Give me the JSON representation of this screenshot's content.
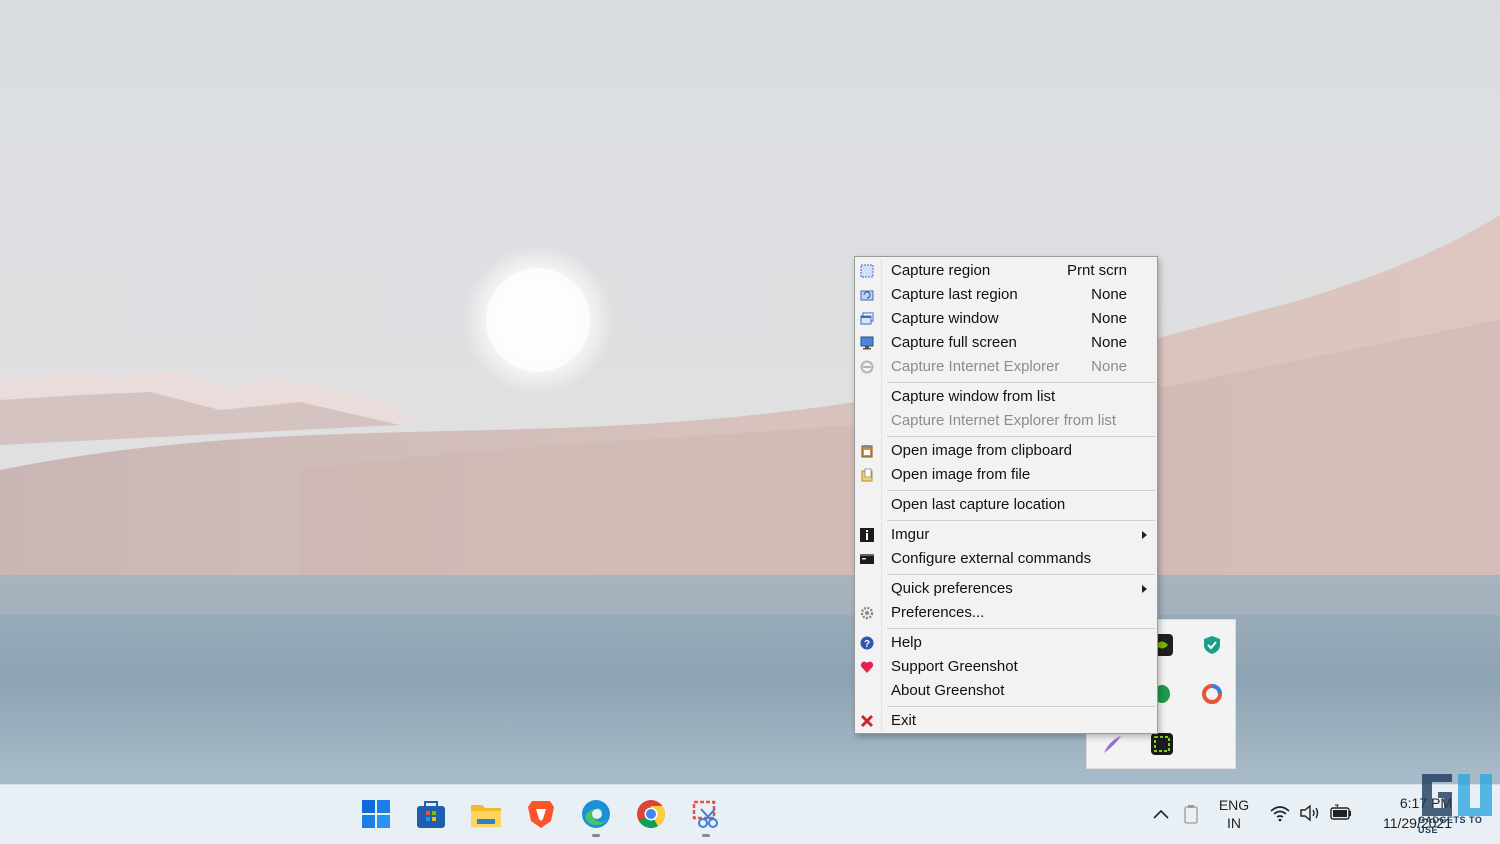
{
  "menu": {
    "items": [
      {
        "label": "Capture region",
        "shortcut": "Prnt scrn",
        "icon": "capture-region-icon",
        "disabled": false
      },
      {
        "label": "Capture last region",
        "shortcut": "None",
        "icon": "capture-last-region-icon",
        "disabled": false
      },
      {
        "label": "Capture window",
        "shortcut": "None",
        "icon": "capture-window-icon",
        "disabled": false
      },
      {
        "label": "Capture full screen",
        "shortcut": "None",
        "icon": "capture-full-screen-icon",
        "disabled": false
      },
      {
        "label": "Capture Internet Explorer",
        "shortcut": "None",
        "icon": "internet-explorer-icon",
        "disabled": true
      },
      {
        "label": "Capture window from list",
        "disabled": false
      },
      {
        "label": "Capture Internet Explorer from list",
        "disabled": true
      },
      {
        "label": "Open image from clipboard",
        "icon": "clipboard-icon",
        "disabled": false
      },
      {
        "label": "Open image from file",
        "icon": "open-file-icon",
        "disabled": false
      },
      {
        "label": "Open last capture location",
        "disabled": false
      },
      {
        "label": "Imgur",
        "icon": "imgur-icon",
        "submenu": true,
        "disabled": false
      },
      {
        "label": "Configure external commands",
        "icon": "command-window-icon",
        "disabled": false
      },
      {
        "label": "Quick preferences",
        "submenu": true,
        "disabled": false
      },
      {
        "label": "Preferences...",
        "icon": "gear-icon",
        "disabled": false
      },
      {
        "label": "Help",
        "icon": "help-icon",
        "disabled": false
      },
      {
        "label": "Support Greenshot",
        "icon": "heart-icon",
        "disabled": false
      },
      {
        "label": "About Greenshot",
        "disabled": false
      },
      {
        "label": "Exit",
        "icon": "exit-x-icon",
        "disabled": false
      }
    ]
  },
  "taskbar": {
    "apps": [
      "windows-start-icon",
      "microsoft-store-icon",
      "file-explorer-icon",
      "brave-browser-icon",
      "edge-browser-icon",
      "chrome-browser-icon",
      "snipping-tool-icon"
    ],
    "tray": {
      "language_line1": "ENG",
      "language_line2": "IN",
      "time": "6:17 PM",
      "date": "11/29/2021"
    }
  },
  "tray_flyout_icons": [
    "nvidia-icon",
    "security-shield-icon",
    "green-leaf-icon",
    "edge-sync-icon",
    "feather-icon",
    "greenshot-icon"
  ],
  "watermark": {
    "text": "GADGETS TO USE"
  },
  "colors": {
    "menu_bg": "#f2f2f2",
    "accent_exit": "#c62828",
    "taskbar_bg": "#e8f0f6"
  }
}
